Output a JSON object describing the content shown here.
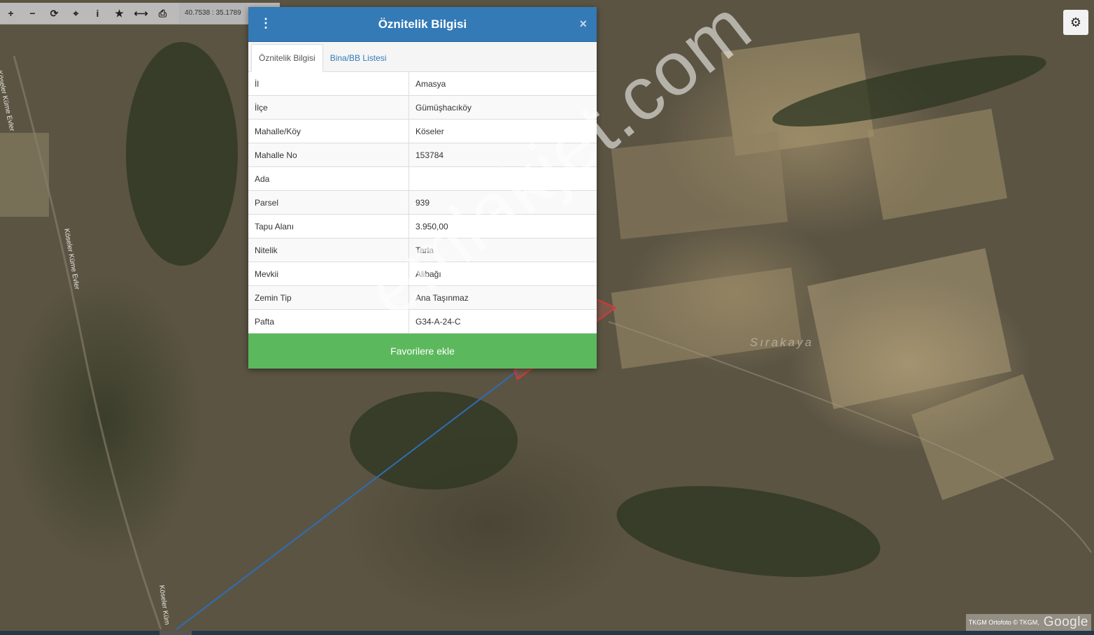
{
  "toolbar": {
    "zoom_in": "+",
    "zoom_out": "−",
    "refresh": "⟳",
    "locate": "⌖",
    "info": "i",
    "favorite": "★",
    "measure": "⟷",
    "print": "⎙",
    "coordinates": "40.7538 : 35.1789"
  },
  "settings_icon": "⚙",
  "map": {
    "watermark": "emlakjet.com",
    "place_label": "Sırakaya",
    "road_label_1": "Köseler Küme Evler",
    "road_label_2": "Köseler Küme Evler",
    "road_label_3": "Köseler Küm",
    "attribution": "TKGM Ortofoto © TKGM,",
    "google": "Google"
  },
  "dialog": {
    "title": "Öznitelik Bilgisi",
    "menu_icon": "⋮",
    "close_icon": "×",
    "tabs": [
      {
        "label": "Öznitelik Bilgisi"
      },
      {
        "label": "Bina/BB Listesi"
      }
    ],
    "rows": [
      {
        "key": "İl",
        "value": "Amasya"
      },
      {
        "key": "İlçe",
        "value": "Gümüşhacıköy"
      },
      {
        "key": "Mahalle/Köy",
        "value": "Köseler"
      },
      {
        "key": "Mahalle No",
        "value": "153784"
      },
      {
        "key": "Ada",
        "value": ""
      },
      {
        "key": "Parsel",
        "value": "939"
      },
      {
        "key": "Tapu Alanı",
        "value": "3.950,00"
      },
      {
        "key": "Nitelik",
        "value": "Tarla"
      },
      {
        "key": "Mevkii",
        "value": "Alibağı"
      },
      {
        "key": "Zemin Tip",
        "value": "Ana Taşınmaz"
      },
      {
        "key": "Pafta",
        "value": "G34-A-24-C"
      }
    ],
    "favorite_button": "Favorilere ekle"
  }
}
